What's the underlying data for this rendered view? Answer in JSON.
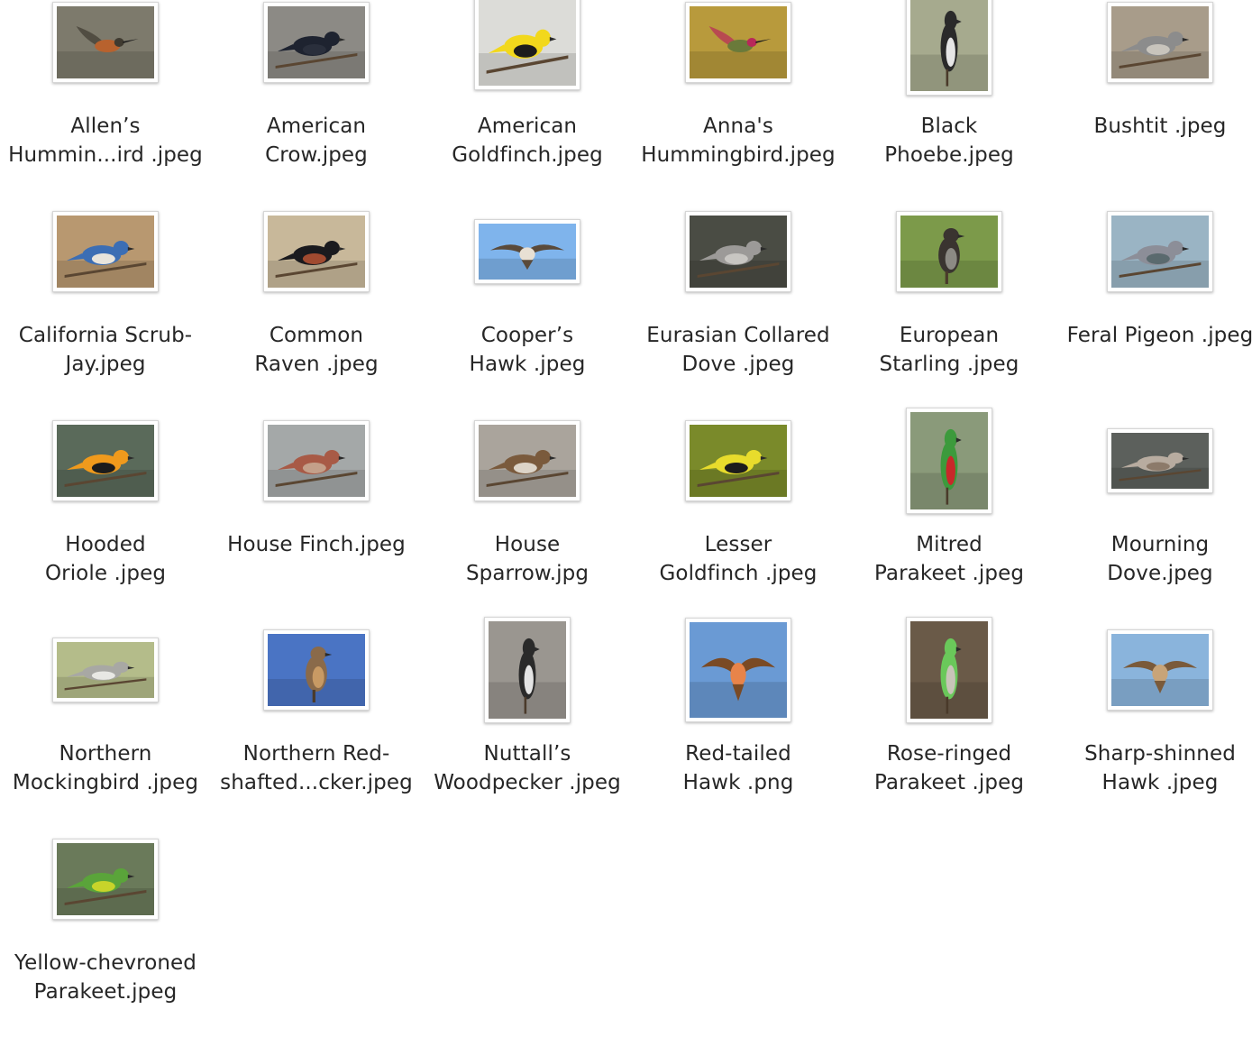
{
  "files": [
    {
      "lines": [
        "Allen’s",
        "Hummin...ird .jpeg"
      ],
      "orient": "landscape",
      "bg": "#7d7a6c",
      "bird": "#b8622e",
      "bird2": "#3f3a30",
      "pose": "hover"
    },
    {
      "lines": [
        "American",
        "Crow.jpeg"
      ],
      "orient": "landscape",
      "bg": "#8c8a85",
      "bird": "#1e2330",
      "bird2": "#2a2f3c",
      "pose": "perch"
    },
    {
      "lines": [
        "American",
        "Goldfinch.jpeg"
      ],
      "orient": "square",
      "bg": "#dcdcd8",
      "bird": "#f2d81c",
      "bird2": "#1c1c1c",
      "pose": "perch"
    },
    {
      "lines": [
        "Anna's",
        "Hummingbird.jpeg"
      ],
      "orient": "landscape",
      "bg": "#b89a3c",
      "bird": "#6a7a3a",
      "bird2": "#b8285a",
      "pose": "hover"
    },
    {
      "lines": [
        "Black",
        "Phoebe.jpeg"
      ],
      "orient": "portrait",
      "bg": "#a6aa8e",
      "bird": "#2a2a2a",
      "bird2": "#e6e6e6",
      "pose": "upright"
    },
    {
      "lines": [
        "Bushtit .jpeg"
      ],
      "orient": "landscape",
      "bg": "#a89c8a",
      "bird": "#8c8c8c",
      "bird2": "#c8c4bc",
      "pose": "perch"
    },
    {
      "lines": [
        "California Scrub-",
        "Jay.jpeg"
      ],
      "orient": "landscape",
      "bg": "#b89870",
      "bird": "#3c6eb4",
      "bird2": "#e8e4dc",
      "pose": "perch"
    },
    {
      "lines": [
        "Common",
        "Raven .jpeg"
      ],
      "orient": "landscape",
      "bg": "#c8b89a",
      "bird": "#1a1a1e",
      "bird2": "#a04a30",
      "pose": "perch"
    },
    {
      "lines": [
        "Cooper’s",
        "Hawk .jpeg"
      ],
      "orient": "wide",
      "bg": "#7fb4ec",
      "bird": "#5a4a3a",
      "bird2": "#e8e0d4",
      "pose": "fly"
    },
    {
      "lines": [
        "Eurasian Collared",
        "Dove .jpeg"
      ],
      "orient": "landscape",
      "bg": "#4a4c44",
      "bird": "#9c9a98",
      "bird2": "#c8c6c2",
      "pose": "perch"
    },
    {
      "lines": [
        "European",
        "Starling .jpeg"
      ],
      "orient": "landscape",
      "bg": "#7c9a4a",
      "bird": "#3a3430",
      "bird2": "#8c8a84",
      "pose": "upright"
    },
    {
      "lines": [
        "Feral Pigeon .jpeg"
      ],
      "orient": "landscape",
      "bg": "#9ab4c4",
      "bird": "#8c8e98",
      "bird2": "#5a6a6e",
      "pose": "perch"
    },
    {
      "lines": [
        "Hooded",
        "Oriole .jpeg"
      ],
      "orient": "landscape",
      "bg": "#5a6a5a",
      "bird": "#f09a1c",
      "bird2": "#1c1c1c",
      "pose": "perch"
    },
    {
      "lines": [
        "House Finch.jpeg"
      ],
      "orient": "landscape",
      "bg": "#a4a8a8",
      "bird": "#a85a46",
      "bird2": "#c4a08a",
      "pose": "perch"
    },
    {
      "lines": [
        "House",
        "Sparrow.jpg"
      ],
      "orient": "landscape",
      "bg": "#aaa49c",
      "bird": "#7a5a3c",
      "bird2": "#dcd4c8",
      "pose": "perch"
    },
    {
      "lines": [
        "Lesser",
        "Goldfinch .jpeg"
      ],
      "orient": "landscape",
      "bg": "#7a8a2a",
      "bird": "#e8dc2c",
      "bird2": "#1c1c1c",
      "pose": "perch"
    },
    {
      "lines": [
        "Mitred",
        "Parakeet .jpeg"
      ],
      "orient": "portrait",
      "bg": "#8a9a7a",
      "bird": "#3c9a3c",
      "bird2": "#c8282a",
      "pose": "upright"
    },
    {
      "lines": [
        "Mourning",
        "Dove.jpeg"
      ],
      "orient": "wide",
      "bg": "#5c605c",
      "bird": "#b8aca0",
      "bird2": "#8c7a6a",
      "pose": "perch"
    },
    {
      "lines": [
        "Northern",
        "Mockingbird .jpeg"
      ],
      "orient": "wide",
      "bg": "#b4bc8a",
      "bird": "#a8a8a4",
      "bird2": "#e8e8e4",
      "pose": "perch"
    },
    {
      "lines": [
        "Northern Red-",
        "shafted...cker.jpeg"
      ],
      "orient": "landscape",
      "bg": "#4a74c4",
      "bird": "#8a6a4a",
      "bird2": "#c89a64",
      "pose": "upright"
    },
    {
      "lines": [
        "Nuttall’s",
        "Woodpecker .jpeg"
      ],
      "orient": "portrait",
      "bg": "#9a9690",
      "bird": "#2a2a2a",
      "bird2": "#e4e4e4",
      "pose": "upright"
    },
    {
      "lines": [
        "Red-tailed",
        "Hawk .png"
      ],
      "orient": "squarish",
      "bg": "#6a9ad4",
      "bird": "#7a4a24",
      "bird2": "#e8844a",
      "pose": "fly"
    },
    {
      "lines": [
        "Rose-ringed",
        "Parakeet .jpeg"
      ],
      "orient": "portrait",
      "bg": "#6a5a48",
      "bird": "#6ac85a",
      "bird2": "#c8c4b8",
      "pose": "upright"
    },
    {
      "lines": [
        "Sharp-shinned",
        "Hawk .jpeg"
      ],
      "orient": "landscape",
      "bg": "#8ab4dc",
      "bird": "#7a5a3a",
      "bird2": "#c8a478",
      "pose": "fly"
    },
    {
      "lines": [
        "Yellow-chevroned",
        "Parakeet.jpeg"
      ],
      "orient": "landscape",
      "bg": "#6a7a5a",
      "bird": "#5aa43a",
      "bird2": "#c8d42a",
      "pose": "perch"
    }
  ]
}
